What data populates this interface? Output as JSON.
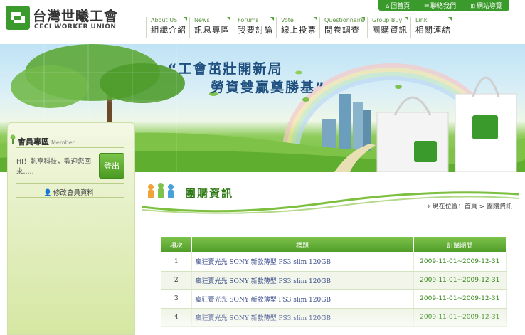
{
  "logo": {
    "cn": "台灣世曦工會",
    "en": "CECI WORKER UNION"
  },
  "toplinks": [
    {
      "label": "回首頁",
      "icon": "home-icon"
    },
    {
      "label": "聯絡我們",
      "icon": "mail-icon"
    },
    {
      "label": "網站導覽",
      "icon": "sitemap-icon"
    }
  ],
  "nav": [
    {
      "en": "About US",
      "cn": "組織介紹"
    },
    {
      "en": "News",
      "cn": "訊息專區"
    },
    {
      "en": "Forums",
      "cn": "我要討論"
    },
    {
      "en": "Vote",
      "cn": "線上投票"
    },
    {
      "en": "Questionnaire",
      "cn": "問卷調查"
    },
    {
      "en": "Group Buy",
      "cn": "團購資訊"
    },
    {
      "en": "Link",
      "cn": "相關連結"
    }
  ],
  "banner": {
    "line1": "“工會茁壯開新局",
    "line2": "勞資雙贏奠勝基”"
  },
  "sidebar": {
    "title": "會員專區",
    "title_en": "Member",
    "welcome": "HI！魁亨科技，歡迎您回來.....",
    "login": "登出",
    "edit": "修改會員資料"
  },
  "main": {
    "title": "團購資訊",
    "breadcrumb": "現在位置：首頁 > 團購資訊"
  },
  "table": {
    "headers": [
      "項次",
      "標題",
      "訂購期間"
    ],
    "rows": [
      [
        "1",
        "瘋狂賣光光 SONY 新款薄型 PS3 slim 120GB",
        "2009-11-01~2009-12-31"
      ],
      [
        "2",
        "瘋狂賣光光 SONY 新款薄型 PS3 slim 120GB",
        "2009-11-01~2009-12-31"
      ],
      [
        "3",
        "瘋狂賣光光 SONY 新款薄型 PS3 slim 120GB",
        "2009-11-01~2009-12-31"
      ],
      [
        "4",
        "瘋狂賣光光 SONY 新款薄型 PS3 slim 120GB",
        "2009-11-01~2009-12-31"
      ]
    ]
  },
  "colors": {
    "brand_green": "#3a9a2b",
    "title_blue": "#1f4f7f"
  }
}
